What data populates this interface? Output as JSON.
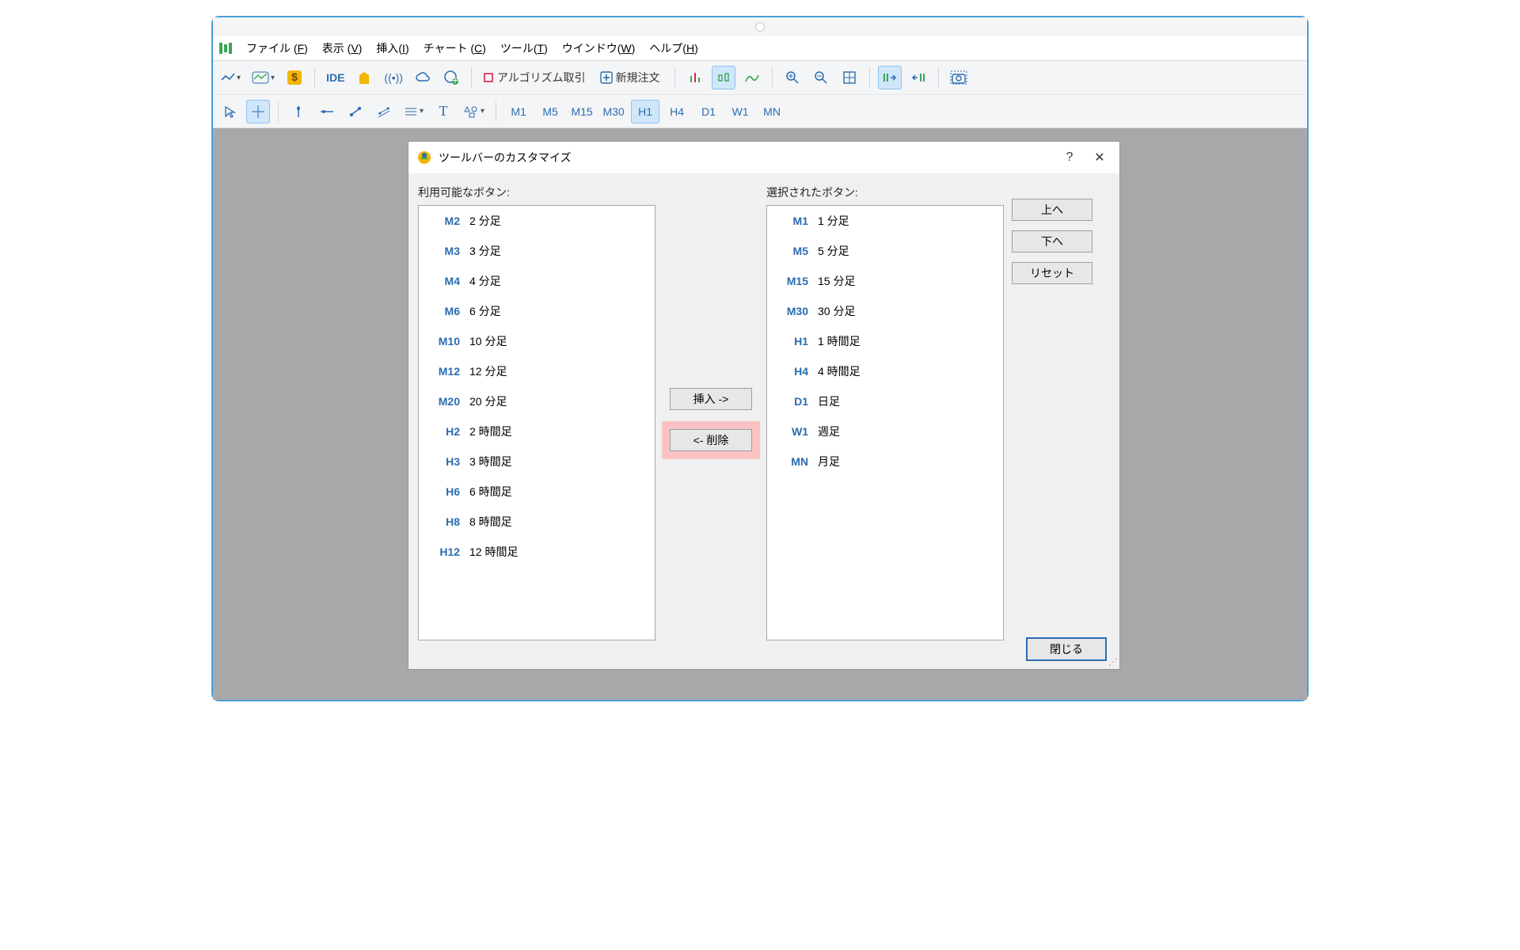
{
  "menu": {
    "file": "ファイル (",
    "file_u": "F",
    "view": "表示 (",
    "view_u": "V",
    "insert": "挿入(",
    "insert_u": "I",
    "chart": "チャート (",
    "chart_u": "C",
    "tools": "ツール(",
    "tools_u": "T",
    "window": "ウインドウ(",
    "window_u": "W",
    "help": "ヘルプ(",
    "help_u": "H",
    "close": ")"
  },
  "toolbar": {
    "ide": "IDE",
    "algo": "アルゴリズム取引",
    "neworder": "新規注文"
  },
  "timeframes_bar": [
    "M1",
    "M5",
    "M15",
    "M30",
    "H1",
    "H4",
    "D1",
    "W1",
    "MN"
  ],
  "timeframes_active": "H1",
  "dialog": {
    "title": "ツールバーのカスタマイズ",
    "available_label": "利用可能なボタン:",
    "selected_label": "選択されたボタン:",
    "insert_btn": "挿入 ->",
    "remove_btn": "<- 削除",
    "up_btn": "上へ",
    "down_btn": "下へ",
    "reset_btn": "リセット",
    "close_btn": "閉じる",
    "available": [
      {
        "code": "M2",
        "label": "2 分足"
      },
      {
        "code": "M3",
        "label": "3 分足"
      },
      {
        "code": "M4",
        "label": "4 分足"
      },
      {
        "code": "M6",
        "label": "6 分足"
      },
      {
        "code": "M10",
        "label": "10 分足"
      },
      {
        "code": "M12",
        "label": "12 分足"
      },
      {
        "code": "M20",
        "label": "20 分足"
      },
      {
        "code": "H2",
        "label": "2 時間足"
      },
      {
        "code": "H3",
        "label": "3 時間足"
      },
      {
        "code": "H6",
        "label": "6 時間足"
      },
      {
        "code": "H8",
        "label": "8 時間足"
      },
      {
        "code": "H12",
        "label": "12 時間足"
      }
    ],
    "selected": [
      {
        "code": "M1",
        "label": "1 分足"
      },
      {
        "code": "M5",
        "label": "5 分足"
      },
      {
        "code": "M15",
        "label": "15 分足"
      },
      {
        "code": "M30",
        "label": "30 分足"
      },
      {
        "code": "H1",
        "label": "1 時間足"
      },
      {
        "code": "H4",
        "label": "4 時間足"
      },
      {
        "code": "D1",
        "label": "日足"
      },
      {
        "code": "W1",
        "label": "週足"
      },
      {
        "code": "MN",
        "label": "月足"
      }
    ]
  }
}
